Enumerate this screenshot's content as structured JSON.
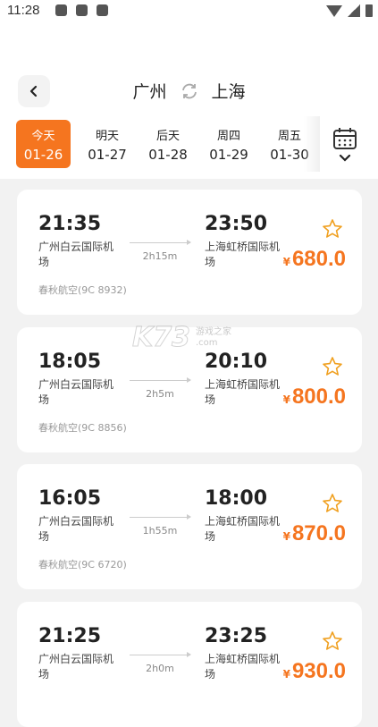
{
  "status_bar": {
    "time": "11:28"
  },
  "header": {
    "from_city": "广州",
    "to_city": "上海"
  },
  "dates": [
    {
      "day": "今天",
      "date": "01-26",
      "active": true
    },
    {
      "day": "明天",
      "date": "01-27",
      "active": false
    },
    {
      "day": "后天",
      "date": "01-28",
      "active": false
    },
    {
      "day": "周四",
      "date": "01-29",
      "active": false
    },
    {
      "day": "周五",
      "date": "01-30",
      "active": false
    }
  ],
  "flights": [
    {
      "dep_time": "21:35",
      "dep_airport": "广州白云国际机场",
      "arr_time": "23:50",
      "arr_airport": "上海虹桥国际机场",
      "duration": "2h15m",
      "airline": "春秋航空(9C 8932)",
      "currency": "¥",
      "price": "680.0"
    },
    {
      "dep_time": "18:05",
      "dep_airport": "广州白云国际机场",
      "arr_time": "20:10",
      "arr_airport": "上海虹桥国际机场",
      "duration": "2h5m",
      "airline": "春秋航空(9C 8856)",
      "currency": "¥",
      "price": "800.0"
    },
    {
      "dep_time": "16:05",
      "dep_airport": "广州白云国际机场",
      "arr_time": "18:00",
      "arr_airport": "上海虹桥国际机场",
      "duration": "1h55m",
      "airline": "春秋航空(9C 6720)",
      "currency": "¥",
      "price": "870.0"
    },
    {
      "dep_time": "21:25",
      "dep_airport": "广州白云国际机场",
      "arr_time": "23:25",
      "arr_airport": "上海虹桥国际机场",
      "duration": "2h0m",
      "airline": "",
      "currency": "¥",
      "price": "930.0"
    }
  ],
  "watermark": {
    "logo": "K73",
    "sub1": "游戏之家",
    "sub2": ".com"
  },
  "colors": {
    "accent": "#f5751f",
    "background": "#f2f2f2",
    "card": "#ffffff"
  }
}
